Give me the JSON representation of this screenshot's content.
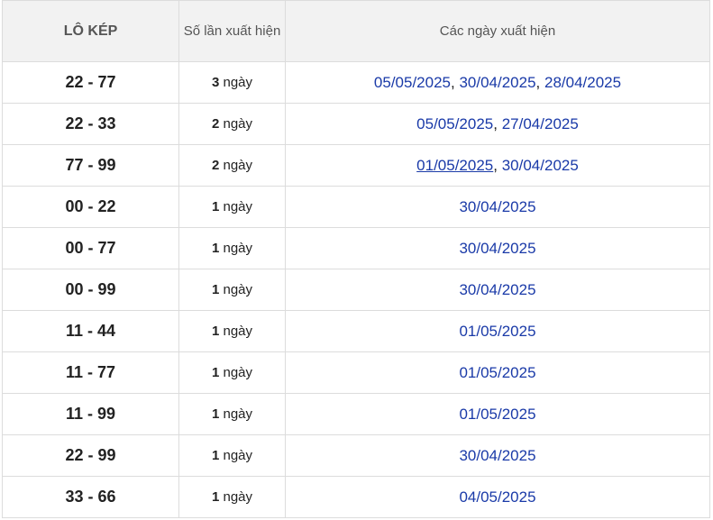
{
  "headers": {
    "col1": "LÔ KÉP",
    "col2": "Số lần xuất hiện",
    "col3": "Các ngày xuất hiện"
  },
  "rows": [
    {
      "pair": "22 - 77",
      "count": "3",
      "unit": " ngày",
      "dates": [
        {
          "text": "05/05/2025"
        },
        {
          "text": "30/04/2025"
        },
        {
          "text": "28/04/2025"
        }
      ]
    },
    {
      "pair": "22 - 33",
      "count": "2",
      "unit": " ngày",
      "dates": [
        {
          "text": "05/05/2025"
        },
        {
          "text": "27/04/2025"
        }
      ]
    },
    {
      "pair": "77 - 99",
      "count": "2",
      "unit": " ngày",
      "dates": [
        {
          "text": "01/05/2025",
          "underlined": true
        },
        {
          "text": "30/04/2025"
        }
      ]
    },
    {
      "pair": "00 - 22",
      "count": "1",
      "unit": " ngày",
      "dates": [
        {
          "text": "30/04/2025"
        }
      ]
    },
    {
      "pair": "00 - 77",
      "count": "1",
      "unit": " ngày",
      "dates": [
        {
          "text": "30/04/2025"
        }
      ]
    },
    {
      "pair": "00 - 99",
      "count": "1",
      "unit": " ngày",
      "dates": [
        {
          "text": "30/04/2025"
        }
      ]
    },
    {
      "pair": "11 - 44",
      "count": "1",
      "unit": " ngày",
      "dates": [
        {
          "text": "01/05/2025"
        }
      ]
    },
    {
      "pair": "11 - 77",
      "count": "1",
      "unit": " ngày",
      "dates": [
        {
          "text": "01/05/2025"
        }
      ]
    },
    {
      "pair": "11 - 99",
      "count": "1",
      "unit": " ngày",
      "dates": [
        {
          "text": "01/05/2025"
        }
      ]
    },
    {
      "pair": "22 - 99",
      "count": "1",
      "unit": " ngày",
      "dates": [
        {
          "text": "30/04/2025"
        }
      ]
    },
    {
      "pair": "33 - 66",
      "count": "1",
      "unit": " ngày",
      "dates": [
        {
          "text": "04/05/2025"
        }
      ]
    }
  ],
  "date_separator": ", ",
  "colors": {
    "link": "#1a3aa8",
    "header_bg": "#f2f2f2",
    "border": "#dcdcdc"
  }
}
